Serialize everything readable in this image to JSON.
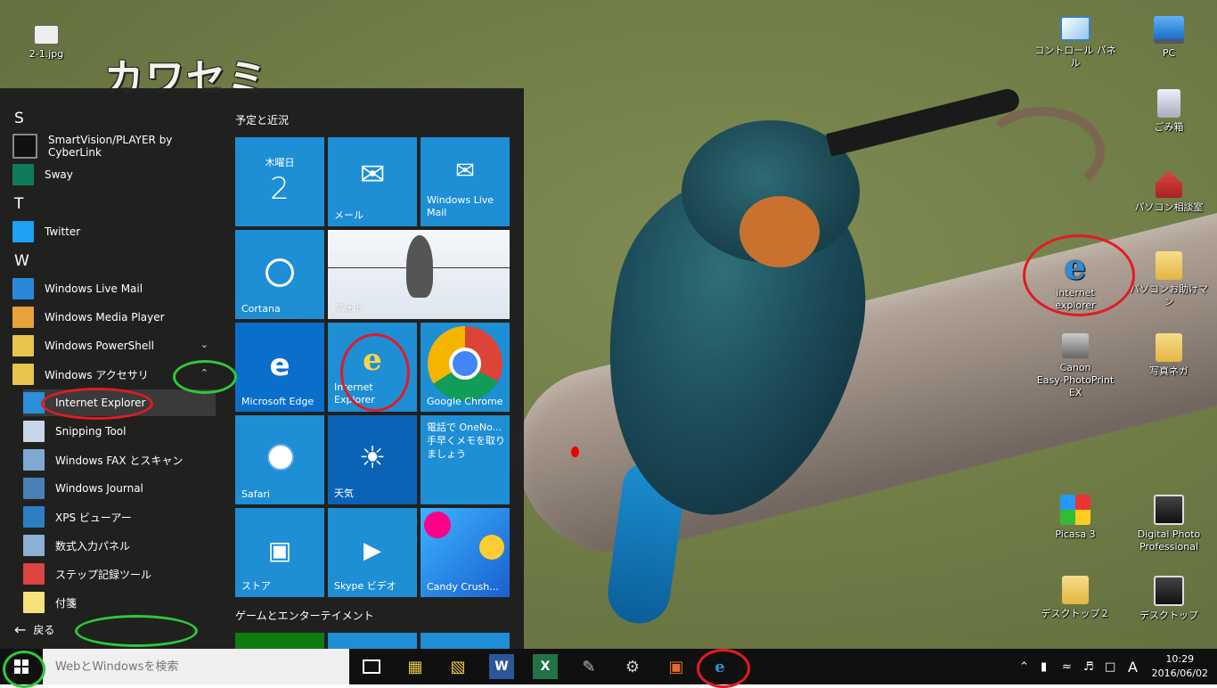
{
  "desktop": {
    "overlay_text": "カワセミ",
    "icons": {
      "file_jpg": "2-1.jpg",
      "control_panel": "コントロール パネル",
      "pc": "PC",
      "recycle_bin": "ごみ箱",
      "pc_consult": "パソコン相談室",
      "internet_explorer": "internet　explorer",
      "pc_helper": "パソコンお助けマン",
      "canon_line1": "Canon",
      "canon_line2": "Easy-PhotoPrint EX",
      "photo_nega": "写真ネガ",
      "picasa": "Picasa 3",
      "dpp_line1": "Digital Photo",
      "dpp_line2": "Professional",
      "desktop2": "デスクトップ２",
      "desktop": "デスクトップ"
    }
  },
  "start_menu": {
    "letters": {
      "s": "S",
      "t": "T",
      "w": "W"
    },
    "apps": {
      "smartvision": "SmartVision/PLAYER by CyberLink",
      "sway": "Sway",
      "twitter": "Twitter",
      "wlm": "Windows Live Mail",
      "wmp": "Windows Media Player",
      "powershell": "Windows PowerShell",
      "accessories": "Windows アクセサリ",
      "ie": "Internet Explorer",
      "snipping": "Snipping Tool",
      "fax": "Windows FAX とスキャン",
      "journal": "Windows Journal",
      "xps": "XPS ビューアー",
      "math": "数式入力パネル",
      "steps": "ステップ記録ツール",
      "sticky": "付箋"
    },
    "back_label": "戻る",
    "tile_groups": {
      "schedule": "予定と近況",
      "games": "ゲームとエンターテイメント"
    },
    "tiles": {
      "calendar_day": "木曜日",
      "calendar_date": "2",
      "mail": "メール",
      "wlm_line1": "Windows Live",
      "wlm_line2": "Mail",
      "cortana": "Cortana",
      "photos": "フォト",
      "edge": "Microsoft Edge",
      "ie_line1": "Internet",
      "ie_line2": "Explorer",
      "chrome": "Google Chrome",
      "safari": "Safari",
      "weather": "天気",
      "onenote_line1": "電話で OneNo...",
      "onenote_line2": "手早くメモを取り",
      "onenote_line3": "ましょう",
      "store": "ストア",
      "skype": "Skype ビデオ",
      "candy": "Candy Crush..."
    }
  },
  "taskbar": {
    "search_placeholder": "WebとWindowsを検索",
    "ime": "A",
    "time": "10:29",
    "date": "2016/06/02"
  }
}
